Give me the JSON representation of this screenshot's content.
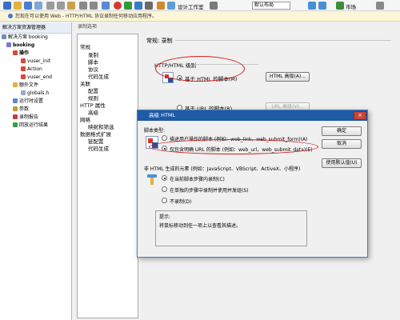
{
  "toolbar": {
    "items": [
      "设计工作室",
      "默认布局",
      "市场"
    ]
  },
  "infobar": {
    "text": "您现在可以使用 Web - HTTP/HTML 协议录制任何移动应用程序。"
  },
  "left_pane": {
    "title": "解决方案资源管理器",
    "tree": [
      "解决方案 booking",
      "booking",
      "操作",
      "vuser_init",
      "Action",
      "vuser_end",
      "额外文件",
      "globals.h",
      "运行时设置",
      "参数",
      "录制报告",
      "回放运行结果"
    ]
  },
  "record_options": {
    "window_title": "录制选项",
    "categories": [
      "常规",
      "录制",
      "脚本",
      "协议",
      "代码生成",
      "关联",
      "配置",
      "规则",
      "HTTP 属性",
      "高级",
      "网络",
      "映射和筛选",
      "数据格式扩展",
      "链配置",
      "代码生成"
    ],
    "section_title": "常规: 录制",
    "group_label": "HTTP/HTML 级别",
    "radio_html": "基于 HTML 的脚本(M)",
    "radio_url": "基于 URL 的脚本(R)",
    "btn_html_adv": "HTML 高级(A)...",
    "btn_url_adv": "URL 高级(V)..."
  },
  "dialog": {
    "title": "高级 HTML",
    "script_type_label": "脚本类型:",
    "opt_user_actions": "描述用户操作的脚本 (例如：web_link，web_submit_form)(A)",
    "opt_explicit_url": "仅包含明确 URL 的脚本 (例如：web_url，web_submit_data)(E)",
    "non_html_label": "非 HTML 生成的元素 (例如：JavaScript、VBScript、ActiveX、小程序)",
    "opt_current_step": "在当前脚本步骤内录制(C)",
    "opt_separate_step": "在单独的步骤中录制并使用并发组(S)",
    "opt_no_record": "不录制(D)",
    "tip_label": "提示:",
    "tip_text": "将鼠标移动到任一项上以查看其描述。",
    "btn_ok": "确定",
    "btn_cancel": "取消",
    "btn_defaults": "使用默认值(U)"
  },
  "colors": {
    "title_bar": "#1f5aa6",
    "highlight_oval": "#d81b1b",
    "info_bar": "#fbf6d8"
  }
}
